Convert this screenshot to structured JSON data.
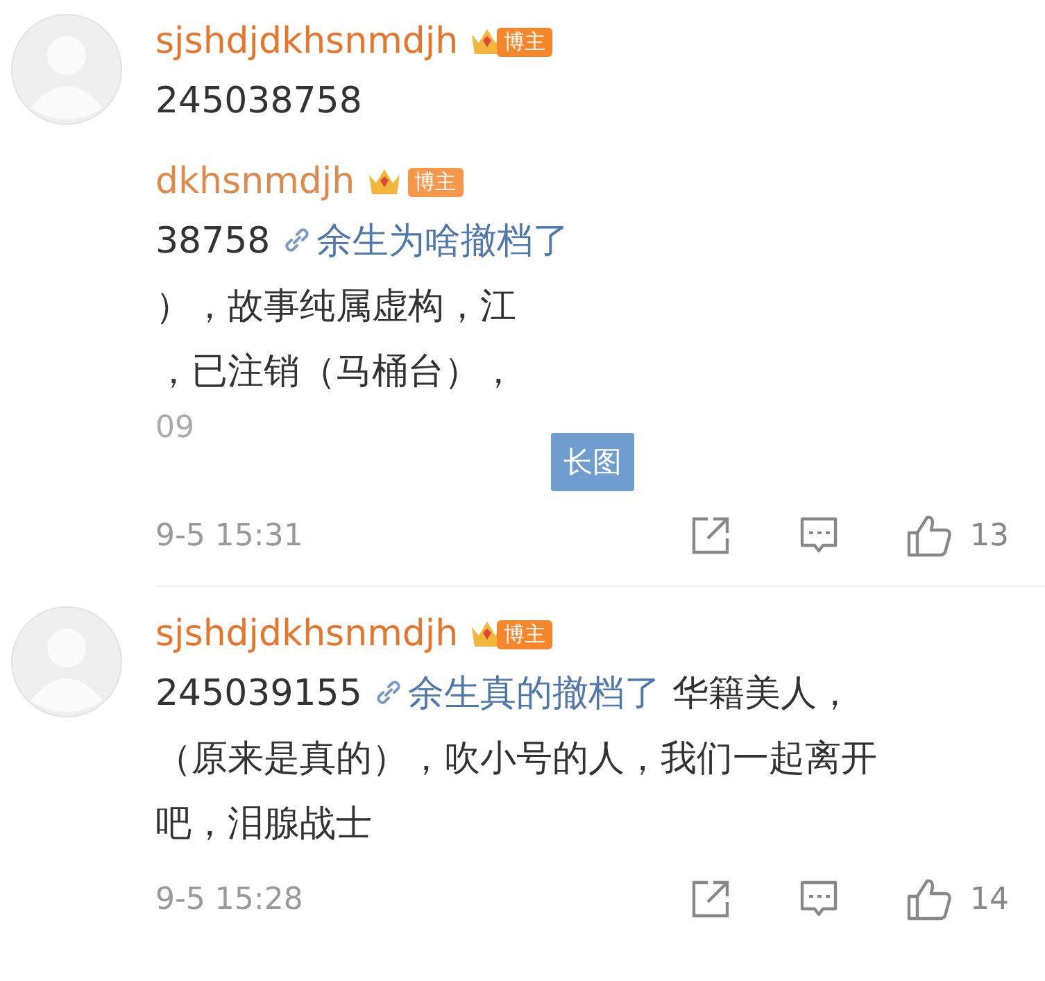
{
  "comments": [
    {
      "author": "sjshdjdkhsnmdjh",
      "badge": "博主",
      "lines": [
        [
          {
            "kind": "text",
            "text": "245038758"
          }
        ]
      ],
      "attachment": {
        "kind": "screenshot",
        "author": "dkhsnmdjh",
        "badge": "博主",
        "lines": [
          [
            {
              "kind": "text",
              "text": "38758 "
            },
            {
              "kind": "link",
              "text": "余生为啥撤档了"
            }
          ],
          [
            {
              "kind": "text",
              "text": "），故事纯属虚构，江"
            }
          ],
          [
            {
              "kind": "text",
              "text": "，已注销（马桶台），"
            }
          ]
        ],
        "time": "09",
        "tag": "长图"
      },
      "time": "9-5 15:31",
      "likes": "13"
    },
    {
      "author": "sjshdjdkhsnmdjh",
      "badge": "博主",
      "lines": [
        [
          {
            "kind": "text",
            "text": "245039155 "
          },
          {
            "kind": "link",
            "text": "余生真的撤档了"
          },
          {
            "kind": "text",
            "text": "  华籍美人，"
          }
        ],
        [
          {
            "kind": "text",
            "text": "（原来是真的），吹小号的人，我们一起离开"
          }
        ],
        [
          {
            "kind": "text",
            "text": "吧，泪腺战士"
          }
        ]
      ],
      "time": "9-5 15:28",
      "likes": "14"
    }
  ]
}
